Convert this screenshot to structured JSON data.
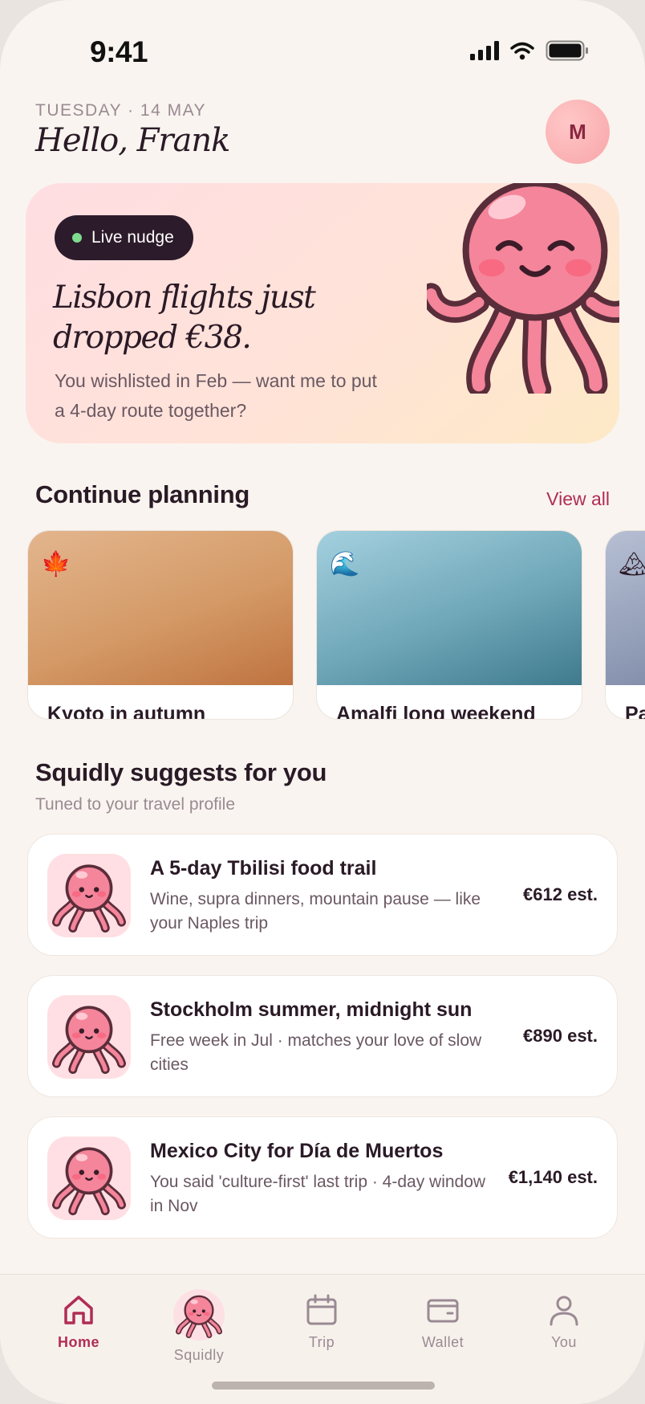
{
  "status_bar": {
    "time": "9:41"
  },
  "header": {
    "date": "TUESDAY · 14 MAY",
    "greeting": "Hello, Frank",
    "avatar_initial": "M"
  },
  "hero": {
    "pill_label": "Live nudge",
    "title": "Lisbon flights just dropped €38.",
    "body": "You wishlisted in Feb — want me to put a 4-day route together?"
  },
  "continue_planning": {
    "title": "Continue planning",
    "view_all": "View all",
    "trips": [
      {
        "name": "Kyoto in autumn",
        "icon": "maple-leaf-icon",
        "emoji": "🍁"
      },
      {
        "name": "Amalfi long weekend",
        "icon": "wave-icon",
        "emoji": "🌊"
      },
      {
        "name": "Pa",
        "icon": "mountain-icon",
        "emoji": "🏔"
      }
    ]
  },
  "suggestions": {
    "title": "Squidly suggests for you",
    "subtitle": "Tuned to your travel profile",
    "items": [
      {
        "title": "A 5-day Tbilisi food trail",
        "desc": "Wine, supra dinners, mountain pause — like your Naples trip",
        "price": "€612 est."
      },
      {
        "title": "Stockholm summer, midnight sun",
        "desc": "Free week in Jul · matches your love of slow cities",
        "price": "€890 est."
      },
      {
        "title": "Mexico City for Día de Muertos",
        "desc": "You said 'culture-first' last trip · 4-day window in Nov",
        "price": "€1,140 est."
      }
    ]
  },
  "tabbar": {
    "tabs": [
      {
        "label": "Home",
        "icon": "home-icon",
        "active": true
      },
      {
        "label": "Squidly",
        "icon": "squidly-icon",
        "active": false
      },
      {
        "label": "Trip",
        "icon": "calendar-icon",
        "active": false
      },
      {
        "label": "Wallet",
        "icon": "wallet-icon",
        "active": false
      },
      {
        "label": "You",
        "icon": "user-icon",
        "active": false
      }
    ]
  },
  "colors": {
    "accent": "#b02d55",
    "background": "#f9f4ef",
    "ink": "#2a1a26",
    "octopus": "#f4859a"
  }
}
